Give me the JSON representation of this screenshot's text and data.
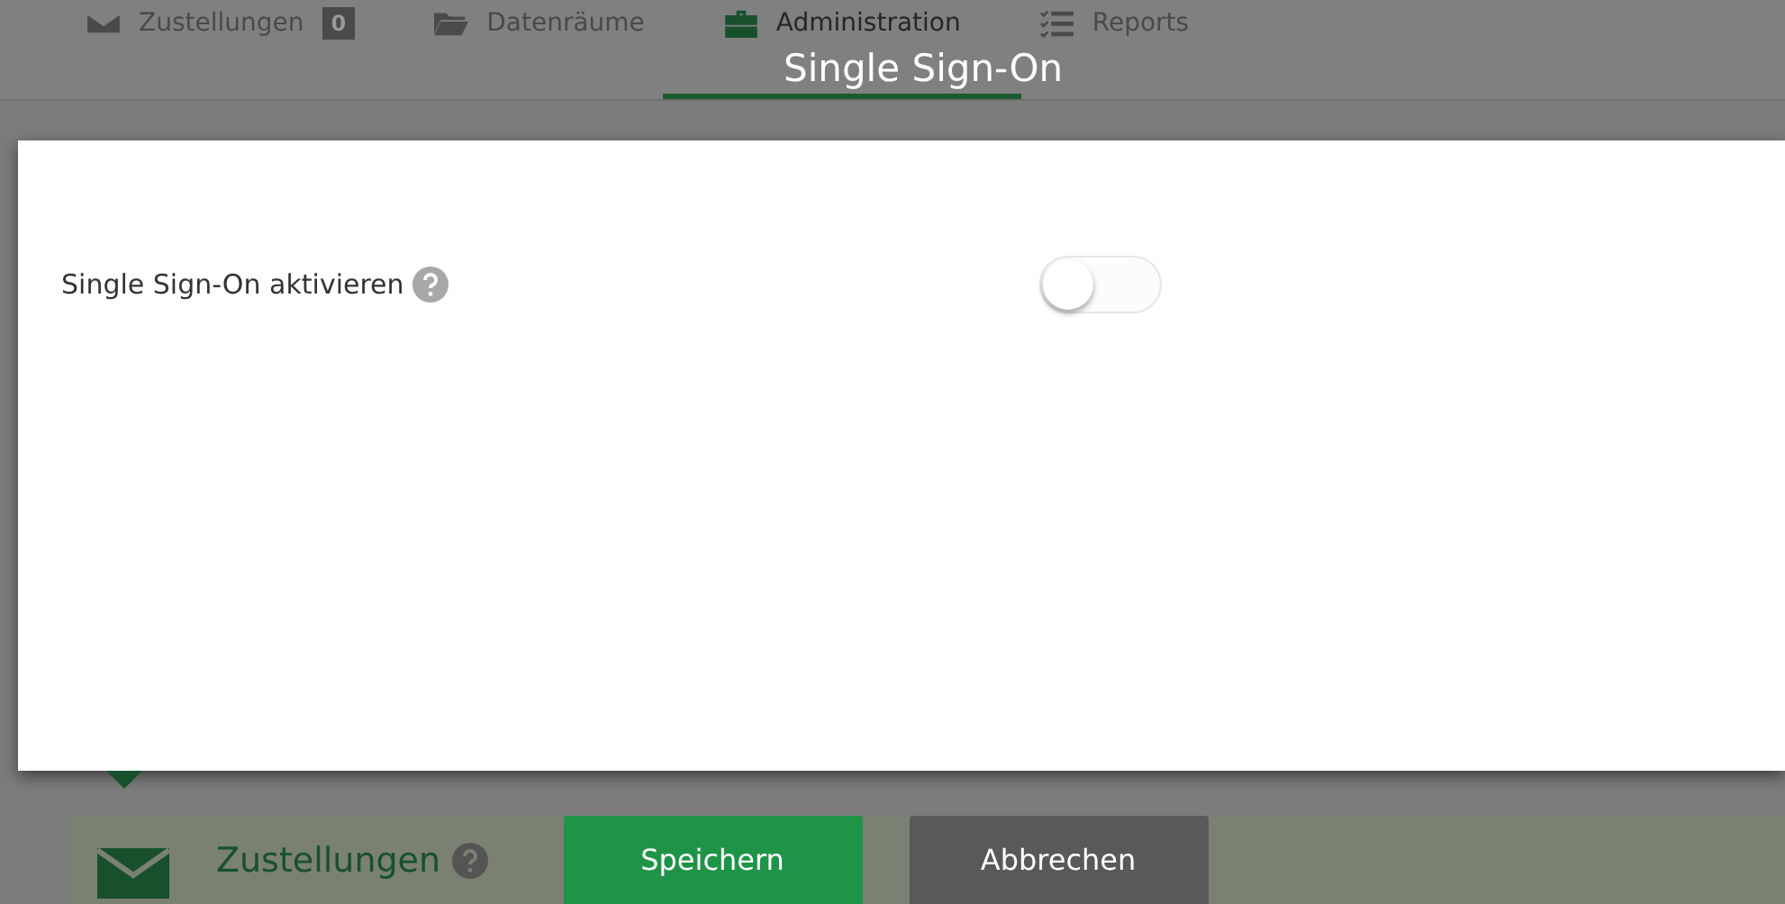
{
  "nav": {
    "tabs": [
      {
        "label": "Zustellungen",
        "badge": "0",
        "selected": false
      },
      {
        "label": "Datenräume",
        "selected": false
      },
      {
        "label": "Administration",
        "selected": true
      },
      {
        "label": "Reports",
        "selected": false
      }
    ]
  },
  "modal": {
    "title": "Single Sign-On",
    "settings": [
      {
        "label": "Single Sign-On aktivieren",
        "on": false
      }
    ],
    "buttons": [
      {
        "label": "Speichern",
        "kind": "primary"
      },
      {
        "label": "Abbrechen",
        "kind": "secondary"
      }
    ]
  },
  "section": {
    "title": "Zustellungen"
  }
}
